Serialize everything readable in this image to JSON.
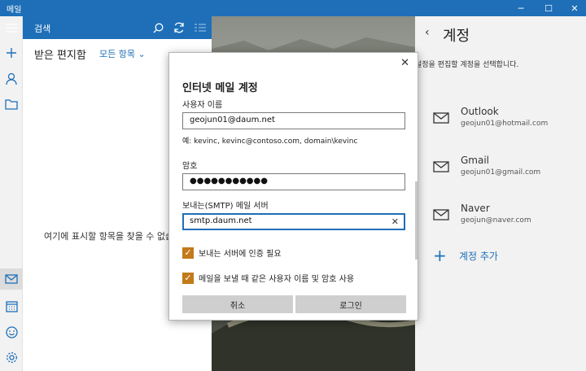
{
  "window": {
    "title": "메일"
  },
  "search": {
    "label": "검색"
  },
  "list": {
    "title": "받은 편지함",
    "filter": "모든 항목",
    "empty_text": "여기에 표시할 항목을 찾을 수 없습"
  },
  "dialog": {
    "title": "인터넷 메일 계정",
    "username_label": "사용자 이름",
    "username_value": "geojun01@daum.net",
    "example_text": "예: kevinc, kevinc@contoso.com, domain\\kevinc",
    "password_label": "암호",
    "password_value": "●●●●●●●●●●●",
    "smtp_label": "보내는(SMTP) 메일 서버",
    "smtp_value": "smtp.daum.net",
    "check1": "보내는 서버에 인증 필요",
    "check2": "메일을 보낼 때 같은 사용자 이름 및 암호 사용",
    "cancel": "취소",
    "login": "로그인"
  },
  "accounts": {
    "title": "계정",
    "subtitle": "설정을 편집할 계정을 선택합니다.",
    "items": [
      {
        "name": "Outlook",
        "email": "geojun01@hotmail.com"
      },
      {
        "name": "Gmail",
        "email": "geojun01@gmail.com"
      },
      {
        "name": "Naver",
        "email": "geojun@naver.com"
      }
    ],
    "add_label": "계정 추가"
  },
  "colors": {
    "accent": "#1e6fb8",
    "checkbox": "#c27a1a"
  },
  "icons": [
    "hamburger-icon",
    "search-icon",
    "sync-icon",
    "select-icon",
    "plus-icon",
    "person-icon",
    "folder-icon",
    "mail-icon",
    "calendar-icon",
    "smiley-icon",
    "gear-icon",
    "back-icon",
    "envelope-icon",
    "close-icon"
  ]
}
